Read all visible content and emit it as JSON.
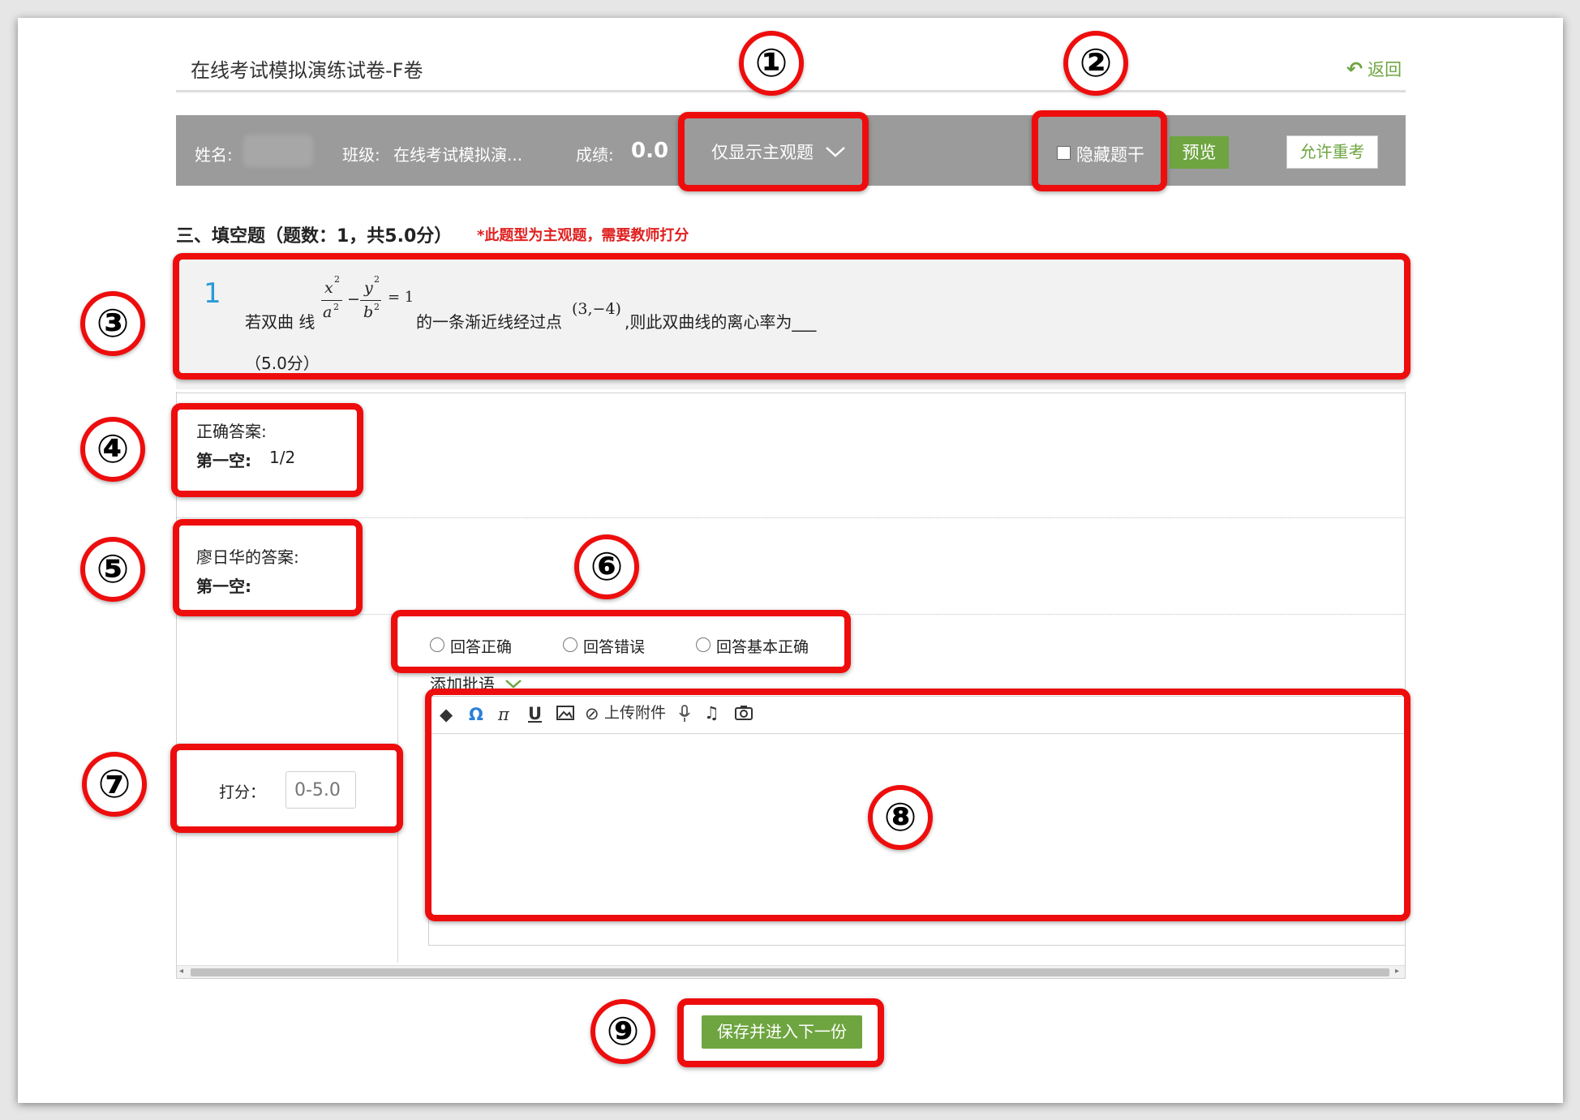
{
  "exam": {
    "title": "在线考试模拟演练试卷-F卷",
    "back_label": "返回"
  },
  "toolbar": {
    "name_label": "姓名:",
    "class_label": "班级:",
    "class_value": "在线考试模拟演...",
    "score_label": "成绩:",
    "score_value": "0.0",
    "filter_value": "仅显示主观题",
    "hide_stem_label": "隐藏题干",
    "preview_label": "预览",
    "retake_label": "允许重考"
  },
  "section": {
    "heading": "三、填空题（题数：1，共5.0分）",
    "note": "*此题型为主观题，需要教师打分"
  },
  "question": {
    "number": "1",
    "text_before": "若双曲 线",
    "formula": {
      "x_num": "x",
      "x_den": "a",
      "y_num": "y",
      "y_den": "b",
      "sup": "2",
      "minus": "−",
      "equals": "= 1"
    },
    "text_middle": "的一条渐近线经过点",
    "point": "(3,−4)",
    "text_after": ",则此双曲线的离心率为___",
    "points": "（5.0分）"
  },
  "correct_answer": {
    "label": "正确答案:",
    "blank_label": "第一空:",
    "blank_value": "1/2"
  },
  "student_answer": {
    "label": "廖日华的答案:",
    "blank_label": "第一空:"
  },
  "judgement": {
    "options": [
      "回答正确",
      "回答错误",
      "回答基本正确"
    ]
  },
  "comment": {
    "label": "添加批语"
  },
  "editor": {
    "attach_label": "上传附件"
  },
  "grading": {
    "label": "打分：",
    "placeholder": "0-5.0"
  },
  "footer": {
    "save_next_label": "保存并进入下一份"
  },
  "annotations": [
    "①",
    "②",
    "③",
    "④",
    "⑤",
    "⑥",
    "⑦",
    "⑧",
    "⑨"
  ],
  "colors": {
    "highlight": "#ee0d0d",
    "toolbar": "#9b9b9b",
    "green": "#6ea540",
    "question_number": "#2b9ad8",
    "note_red": "#e02020"
  }
}
